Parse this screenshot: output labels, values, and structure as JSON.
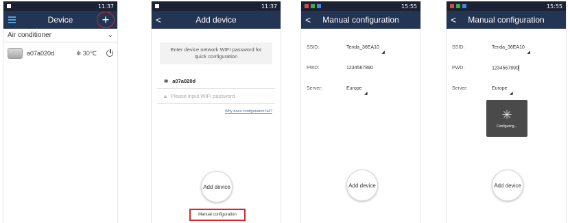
{
  "screen1": {
    "status_time": "11:37",
    "title": "Device",
    "category": "Air conditioner",
    "device": {
      "name": "a07a020d",
      "temp": "30℃"
    }
  },
  "screen2": {
    "status_time": "11:37",
    "title": "Add device",
    "hint": "Enter device network WIFI password for quick configuration",
    "ssid": "a07a020d",
    "password_placeholder": "Please input WIFI password",
    "help_link": "Why does configuration fail?",
    "add_button": "Add device",
    "manual_link": "Manual configuration"
  },
  "screen3": {
    "status_time": "15:55",
    "title": "Manual configuration",
    "ssid_label": "SSID:",
    "ssid_value": "Tenda_36EA10",
    "pwd_label": "PWD:",
    "pwd_value": "1234567890",
    "server_label": "Server:",
    "server_value": "Europe",
    "add_button": "Add device"
  },
  "screen4": {
    "status_time": "15:55",
    "title": "Manual configuration",
    "ssid_label": "SSID:",
    "ssid_value": "Tenda_36EA10",
    "pwd_label": "PWD:",
    "pwd_value": "1234567890",
    "server_label": "Server:",
    "server_value": "Europe",
    "loading_text": "Configuring...",
    "add_button": "Add device"
  },
  "icons": [
    "menu-icon",
    "add-icon",
    "back-icon",
    "chevron-down-icon",
    "power-icon",
    "wifi-icon",
    "lock-icon",
    "spinner-icon"
  ],
  "colors": {
    "appbar": "#243553",
    "statusbar": "#1b2236",
    "highlight": "#d9262b"
  }
}
